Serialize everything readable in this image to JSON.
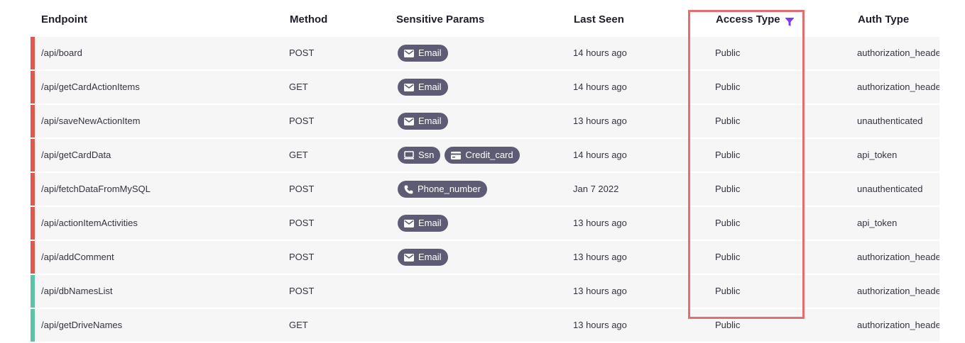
{
  "columns": {
    "endpoint": "Endpoint",
    "method": "Method",
    "sensitive_params": "Sensitive Params",
    "last_seen": "Last Seen",
    "access_type": "Access Type",
    "auth_type": "Auth Type"
  },
  "colors": {
    "risk_high": "#e0574f",
    "risk_low": "#5ec2a6",
    "pill_bg": "#5e5c74",
    "filter_icon": "#7c3aed",
    "highlight_border": "#e46d6f"
  },
  "rows": [
    {
      "endpoint": "/api/board",
      "method": "POST",
      "params": [
        {
          "icon": "email-icon",
          "label": "Email"
        }
      ],
      "last_seen": "14 hours ago",
      "access_type": "Public",
      "auth_type": "authorization_header",
      "risk": "high"
    },
    {
      "endpoint": "/api/getCardActionItems",
      "method": "GET",
      "params": [
        {
          "icon": "email-icon",
          "label": "Email"
        }
      ],
      "last_seen": "14 hours ago",
      "access_type": "Public",
      "auth_type": "authorization_header",
      "risk": "high"
    },
    {
      "endpoint": "/api/saveNewActionItem",
      "method": "POST",
      "params": [
        {
          "icon": "email-icon",
          "label": "Email"
        }
      ],
      "last_seen": "13 hours ago",
      "access_type": "Public",
      "auth_type": "unauthenticated",
      "risk": "high"
    },
    {
      "endpoint": "/api/getCardData",
      "method": "GET",
      "params": [
        {
          "icon": "monitor-icon",
          "label": "Ssn"
        },
        {
          "icon": "credit-card-icon",
          "label": "Credit_card"
        }
      ],
      "last_seen": "14 hours ago",
      "access_type": "Public",
      "auth_type": "api_token",
      "risk": "high"
    },
    {
      "endpoint": "/api/fetchDataFromMySQL",
      "method": "POST",
      "params": [
        {
          "icon": "phone-icon",
          "label": "Phone_number"
        }
      ],
      "last_seen": "Jan 7 2022",
      "access_type": "Public",
      "auth_type": "unauthenticated",
      "risk": "high"
    },
    {
      "endpoint": "/api/actionItemActivities",
      "method": "POST",
      "params": [
        {
          "icon": "email-icon",
          "label": "Email"
        }
      ],
      "last_seen": "13 hours ago",
      "access_type": "Public",
      "auth_type": "api_token",
      "risk": "high"
    },
    {
      "endpoint": "/api/addComment",
      "method": "POST",
      "params": [
        {
          "icon": "email-icon",
          "label": "Email"
        }
      ],
      "last_seen": "13 hours ago",
      "access_type": "Public",
      "auth_type": "authorization_header",
      "risk": "high"
    },
    {
      "endpoint": "/api/dbNamesList",
      "method": "POST",
      "params": [],
      "last_seen": "13 hours ago",
      "access_type": "Public",
      "auth_type": "authorization_header",
      "risk": "low"
    },
    {
      "endpoint": "/api/getDriveNames",
      "method": "GET",
      "params": [],
      "last_seen": "13 hours ago",
      "access_type": "Public",
      "auth_type": "authorization_header",
      "risk": "low"
    }
  ]
}
